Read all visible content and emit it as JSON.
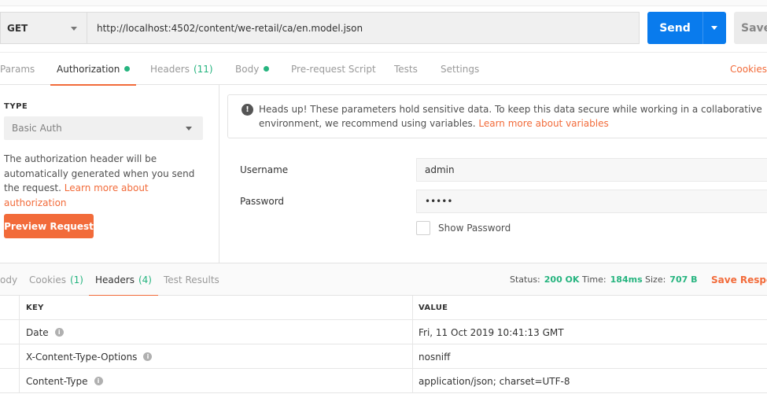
{
  "request": {
    "method": "GET",
    "url": "http://localhost:4502/content/we-retail/ca/en.model.json",
    "send_label": "Send",
    "save_label": "Save"
  },
  "request_tabs": [
    {
      "label": "Params"
    },
    {
      "label": "Authorization",
      "active": true,
      "dot": true
    },
    {
      "label": "Headers",
      "count": "(11)"
    },
    {
      "label": "Body",
      "dot": true
    },
    {
      "label": "Pre-request Script"
    },
    {
      "label": "Tests"
    },
    {
      "label": "Settings"
    }
  ],
  "cookies_link": "Cookies",
  "auth": {
    "type_label": "TYPE",
    "type_value": "Basic Auth",
    "help_text": "The authorization header will be automatically generated when you send the request. ",
    "help_link": "Learn more about authorization",
    "preview_button": "Preview Request",
    "notice_text": "Heads up! These parameters hold sensitive data. To keep this data secure while working in a collaborative environment, we recommend using variables. ",
    "notice_link": "Learn more about variables",
    "username_label": "Username",
    "username_value": "admin",
    "password_label": "Password",
    "password_value": "•••••",
    "show_password_label": "Show Password"
  },
  "response_tabs": [
    {
      "label": "ody"
    },
    {
      "label": "Cookies",
      "count": "(1)"
    },
    {
      "label": "Headers",
      "count": "(4)",
      "active": true
    },
    {
      "label": "Test Results"
    }
  ],
  "response_status": {
    "status_label": "Status:",
    "status_value": "200 OK",
    "time_label": "Time:",
    "time_value": "184ms",
    "size_label": "Size:",
    "size_value": "707 B",
    "save_response": "Save Respon"
  },
  "headers_table": {
    "columns": [
      "KEY",
      "VALUE"
    ],
    "rows": [
      {
        "key": "Date",
        "value": "Fri, 11 Oct 2019 10:41:13 GMT"
      },
      {
        "key": "X-Content-Type-Options",
        "value": "nosniff"
      },
      {
        "key": "Content-Type",
        "value": "application/json; charset=UTF-8"
      }
    ]
  },
  "colors": {
    "accent": "#f26b3a",
    "send_blue": "#097bed",
    "success_green": "#26b47f"
  },
  "icons": [
    "chevron-down-icon",
    "info-circle-icon",
    "checkbox-icon"
  ]
}
